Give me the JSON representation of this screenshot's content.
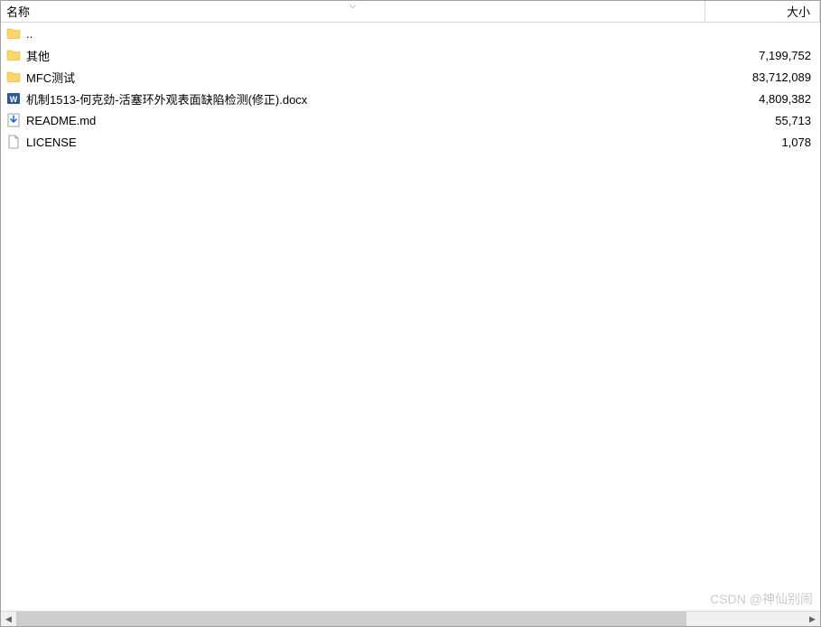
{
  "header": {
    "name_label": "名称",
    "size_label": "大小",
    "sort_indicator": "⌵"
  },
  "files": [
    {
      "type": "folder-up",
      "name": "..",
      "size": ""
    },
    {
      "type": "folder",
      "name": "其他",
      "size": "7,199,752"
    },
    {
      "type": "folder",
      "name": "MFC测试",
      "size": "83,712,089"
    },
    {
      "type": "word",
      "name": "机制1513-何克劲-活塞环外观表面缺陷检测(修正).docx",
      "size": "4,809,382"
    },
    {
      "type": "download",
      "name": "README.md",
      "size": "55,713"
    },
    {
      "type": "file",
      "name": "LICENSE",
      "size": "1,078"
    }
  ],
  "watermark": "CSDN @神仙别闹"
}
